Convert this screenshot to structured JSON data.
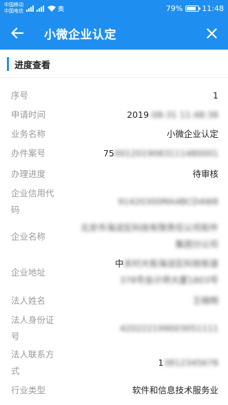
{
  "status_bar": {
    "carrier_1": "中国移动",
    "carrier_2": "中国电信",
    "extra": "奥",
    "battery_text": "79%",
    "battery_level": 0.79,
    "time": "11:48"
  },
  "header": {
    "title": "小微企业认定",
    "back_icon": "arrow-left-icon",
    "close_icon": "close-icon"
  },
  "section": {
    "title": "进度查看"
  },
  "fields": [
    {
      "label": "序号",
      "value": "1"
    },
    {
      "label": "申请时间",
      "value_prefix": "2019",
      "value_hidden": "-08-31 11:48:38"
    },
    {
      "label": "业务名称",
      "value": "小微企业认定"
    },
    {
      "label": "办件案号",
      "value_prefix": "75",
      "value_hidden": "0012019083111480001"
    },
    {
      "label": "办理进度",
      "value": "待审核"
    },
    {
      "label_line1": "企业信用代",
      "label_line2": "码",
      "value_hidden": "91420300MA4BCD4W8"
    },
    {
      "label": "企业名称",
      "value_line1_hidden": "北京市海淀区科技有限责任公司软件",
      "value_line2_hidden": "集团分公司"
    },
    {
      "label": "企业地址",
      "value_line1_prefix": "中",
      "value_line1_hidden": "关村大街海淀区科技街道",
      "value_line2_hidden": "378号会计师大厦1803号"
    },
    {
      "label": "法人姓名",
      "value_hidden": "王晓明"
    },
    {
      "label_line1": "法人身份证",
      "label_line2": "号",
      "value_hidden": "420222199003051111"
    },
    {
      "label_line1": "法人联系方",
      "label_line2": "式",
      "value_prefix": "1",
      "value_hidden": "3812345678"
    },
    {
      "label": "行业类型",
      "value": "软件和信息技术服务业"
    }
  ],
  "colors": {
    "primary": "#1e8ff0",
    "label": "#9a9a9a",
    "text": "#222222"
  }
}
